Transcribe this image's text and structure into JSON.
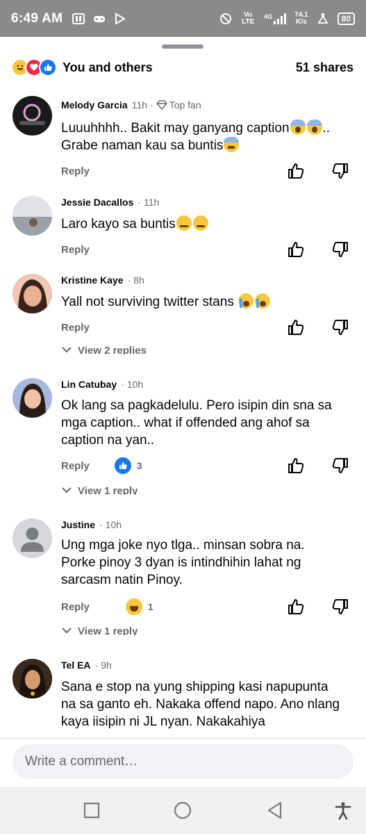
{
  "status_bar": {
    "time": "6:49 AM",
    "network_type": "Vo LTE",
    "signal": "4G",
    "speed_value": "74.1",
    "speed_unit": "K/s",
    "battery": "80"
  },
  "reactions_summary": {
    "label": "You and others",
    "shares": "51 shares",
    "reaction_icons": [
      "haha-icon",
      "love-icon",
      "like-icon"
    ]
  },
  "comments": [
    {
      "name": "Melody Garcia",
      "time": "11h",
      "badge": "Top fan",
      "text_parts": [
        "Luuuhhhh.. Bakit may ganyang caption",
        "..",
        "Grabe naman kau sa buntis"
      ],
      "reply_label": "Reply"
    },
    {
      "name": "Jessie Dacallos",
      "time": "11h",
      "text": "Laro kayo sa buntis",
      "reply_label": "Reply"
    },
    {
      "name": "Kristine Kaye",
      "time": "8h",
      "text": "Yall not surviving twitter stans",
      "reply_label": "Reply",
      "view_replies": "View 2 replies"
    },
    {
      "name": "Lin Catubay",
      "time": "10h",
      "text": "Ok lang sa pagkadelulu. Pero isipin din sna sa mga caption.. what if offended ang ahof sa caption na yan..",
      "reply_label": "Reply",
      "reaction_count": "3",
      "view_replies": "View 1 reply"
    },
    {
      "name": "Justine",
      "time": "10h",
      "text": "Ung mga joke nyo tlga.. minsan sobra na. Porke pinoy 3 dyan is intindhihin lahat ng sarcasm natin Pinoy.",
      "reply_label": "Reply",
      "reaction_count": "1",
      "view_replies": "View 1 reply"
    },
    {
      "name": "Tel EA",
      "time": "9h",
      "text": "Sana e stop na yung shipping kasi napupunta na sa ganto eh.  Nakaka offend napo. Ano nlang kaya iisipin ni JL nyan. Nakakahiya"
    }
  ],
  "composer": {
    "placeholder": "Write a comment…"
  },
  "colors": {
    "status_bar": "#8a8a8a",
    "facebook_blue": "#1877f2",
    "secondary_text": "#65676b",
    "composer_bg": "#f0f2f5"
  }
}
